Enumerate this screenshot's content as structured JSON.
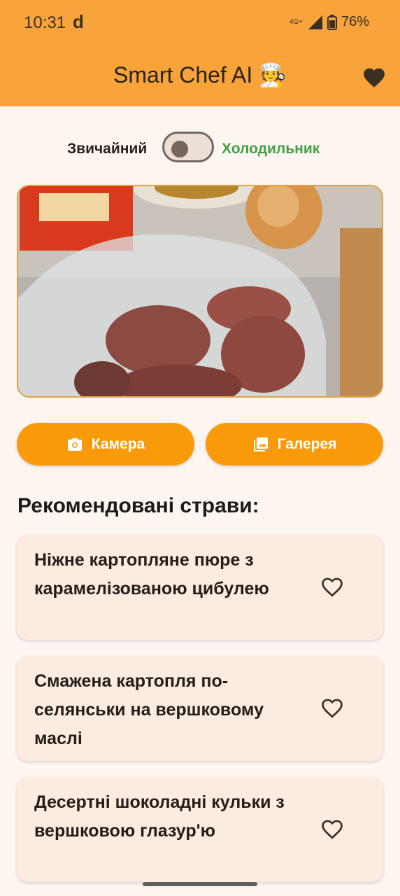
{
  "status_bar": {
    "time": "10:31",
    "carrier_mark": "d",
    "network": "4G+",
    "battery": "76%"
  },
  "app_bar": {
    "title": "Smart Chef AI 🧑‍🍳",
    "favorites_icon": "heart-filled-icon"
  },
  "mode_toggle": {
    "left_label": "Звичайний",
    "right_label": "Холодильник",
    "state": "off",
    "active_color": "#43a047"
  },
  "photo": {
    "description_icon": "ingredients-photo"
  },
  "buttons": {
    "camera_label": "Камера",
    "gallery_label": "Галерея",
    "color": "#f99a0a"
  },
  "recommendations": {
    "title": "Рекомендовані страви:",
    "items": [
      {
        "name": "Ніжне картопляне пюре з карамелізованою цибулею"
      },
      {
        "name": "Смажена картопля по-селянськи на вершковому маслі"
      },
      {
        "name": "Десертні шоколадні кульки з вершковою глазур'ю"
      }
    ]
  },
  "colors": {
    "accent": "#f8a43b",
    "background": "#fdf5f0",
    "card": "#fbebe1"
  }
}
